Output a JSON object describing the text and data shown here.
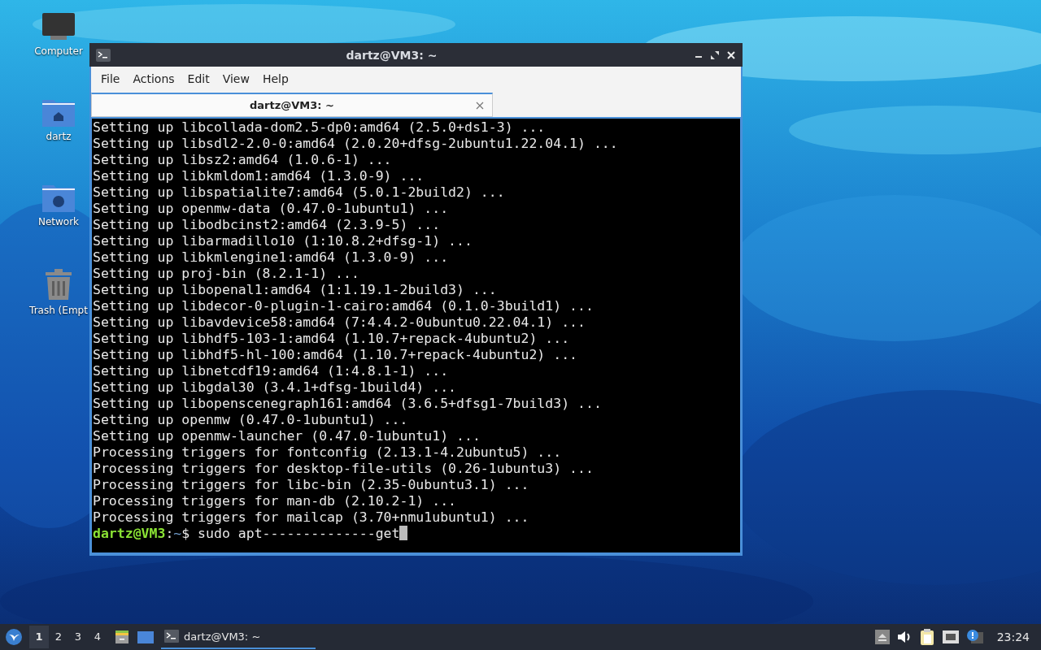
{
  "desktop_icons": [
    {
      "label": "Computer",
      "kind": "computer"
    },
    {
      "label": "dartz",
      "kind": "home"
    },
    {
      "label": "Network",
      "kind": "network"
    },
    {
      "label": "Trash (Empt",
      "kind": "trash"
    }
  ],
  "window": {
    "title": "dartz@VM3: ~",
    "menu": [
      "File",
      "Actions",
      "Edit",
      "View",
      "Help"
    ],
    "tabs": [
      {
        "label": "dartz@VM3: ~",
        "selected": true
      }
    ],
    "terminal": {
      "lines": [
        "Setting up libcollada-dom2.5-dp0:amd64 (2.5.0+ds1-3) ...",
        "Setting up libsdl2-2.0-0:amd64 (2.0.20+dfsg-2ubuntu1.22.04.1) ...",
        "Setting up libsz2:amd64 (1.0.6-1) ...",
        "Setting up libkmldom1:amd64 (1.3.0-9) ...",
        "Setting up libspatialite7:amd64 (5.0.1-2build2) ...",
        "Setting up openmw-data (0.47.0-1ubuntu1) ...",
        "Setting up libodbcinst2:amd64 (2.3.9-5) ...",
        "Setting up libarmadillo10 (1:10.8.2+dfsg-1) ...",
        "Setting up libkmlengine1:amd64 (1.3.0-9) ...",
        "Setting up proj-bin (8.2.1-1) ...",
        "Setting up libopenal1:amd64 (1:1.19.1-2build3) ...",
        "Setting up libdecor-0-plugin-1-cairo:amd64 (0.1.0-3build1) ...",
        "Setting up libavdevice58:amd64 (7:4.4.2-0ubuntu0.22.04.1) ...",
        "Setting up libhdf5-103-1:amd64 (1.10.7+repack-4ubuntu2) ...",
        "Setting up libhdf5-hl-100:amd64 (1.10.7+repack-4ubuntu2) ...",
        "Setting up libnetcdf19:amd64 (1:4.8.1-1) ...",
        "Setting up libgdal30 (3.4.1+dfsg-1build4) ...",
        "Setting up libopenscenegraph161:amd64 (3.6.5+dfsg1-7build3) ...",
        "Setting up openmw (0.47.0-1ubuntu1) ...",
        "Setting up openmw-launcher (0.47.0-1ubuntu1) ...",
        "Processing triggers for fontconfig (2.13.1-4.2ubuntu5) ...",
        "Processing triggers for desktop-file-utils (0.26-1ubuntu3) ...",
        "Processing triggers for libc-bin (2.35-0ubuntu3.1) ...",
        "Processing triggers for man-db (2.10.2-1) ...",
        "Processing triggers for mailcap (3.70+nmu1ubuntu1) ..."
      ],
      "prompt": {
        "user_host": "dartz@VM3",
        "separator": ":",
        "path": "~",
        "symbol": "$",
        "command": "sudo apt--------------get",
        "cursor": true
      }
    }
  },
  "taskbar": {
    "workspaces": [
      {
        "label": "1",
        "selected": true
      },
      {
        "label": "2",
        "selected": false
      },
      {
        "label": "3",
        "selected": false
      },
      {
        "label": "4",
        "selected": false
      }
    ],
    "tasks": [
      {
        "label": "dartz@VM3: ~",
        "selected": true
      }
    ],
    "clock": "23:24"
  }
}
